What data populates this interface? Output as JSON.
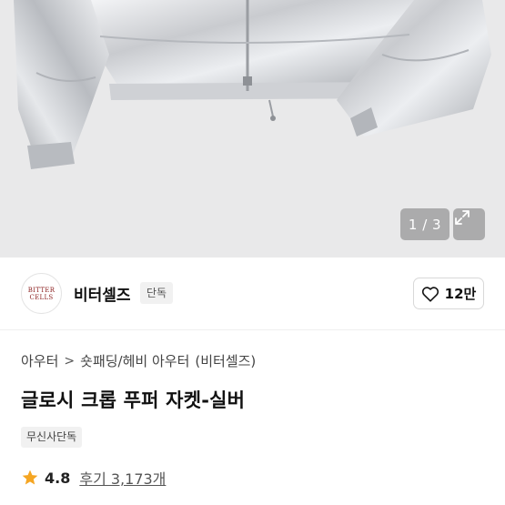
{
  "gallery": {
    "pager_text": "1 / 3",
    "background_color": "#e9e9ea"
  },
  "brand": {
    "logo_line1": "BITTER",
    "logo_line2": "CELLS",
    "name": "비터셀즈",
    "badge": "단독"
  },
  "like": {
    "count": "12만",
    "icon": "heart-outline-icon"
  },
  "breadcrumb": {
    "category": "아우터",
    "subcategory": "숏패딩/헤비 아우터",
    "brand": "(비터셀즈)"
  },
  "product": {
    "title": "글로시 크롭 푸퍼 자켓-실버",
    "exclusive_badge": "무신사단독"
  },
  "rating": {
    "value": "4.8",
    "reviews_text": "후기 3,173개",
    "star_color": "#f5a623"
  }
}
